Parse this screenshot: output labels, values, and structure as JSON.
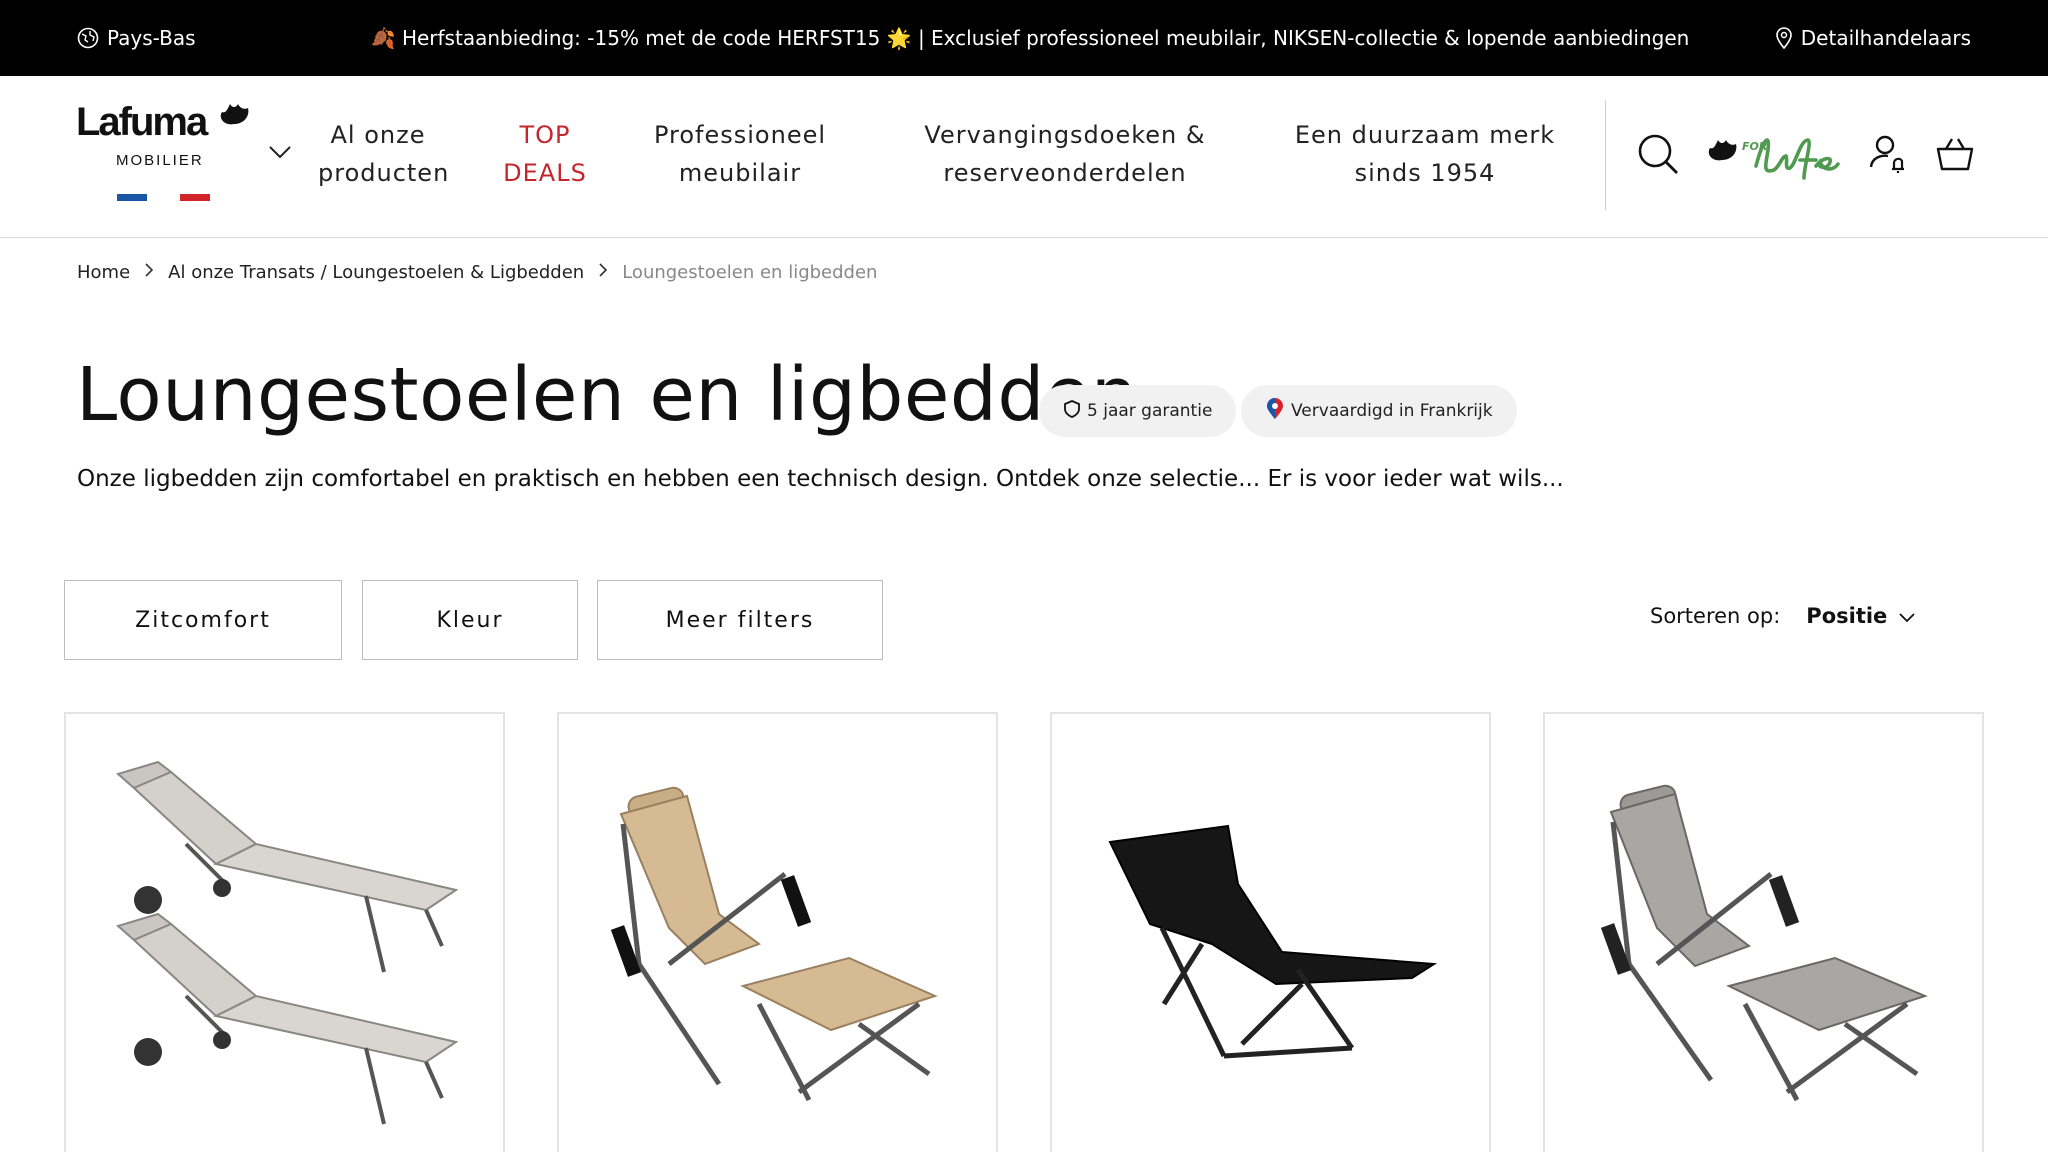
{
  "topbar": {
    "country": "Pays-Bas",
    "promo": "🍂 Herfstaanbieding: -15% met de code HERFST15 🌟 | Exclusief professioneel meubilair, NIKSEN-collectie & lopende aanbiedingen",
    "retailers": "Detailhandelaars"
  },
  "logo": {
    "brand": "Lafuma",
    "sub": "MOBILIER"
  },
  "nav": {
    "items": [
      {
        "line1": "Al onze",
        "line2": "producten"
      },
      {
        "line1": "TOP",
        "line2": "DEALS"
      },
      {
        "line1": "Professioneel",
        "line2": "meubilair"
      },
      {
        "line1": "Vervangingsdoeken &",
        "line2": "reserveonderdelen"
      },
      {
        "line1": "Een duurzaam merk",
        "line2": "sinds 1954"
      }
    ],
    "forlife_label": "FOR",
    "forlife_script": "life"
  },
  "breadcrumb": {
    "items": [
      "Home",
      "Al onze Transats / Loungestoelen & Ligbedden"
    ],
    "current": "Loungestoelen en ligbedden"
  },
  "page": {
    "title": "Loungestoelen en ligbedden",
    "badges": [
      "5 jaar garantie",
      "Vervaardigd in Frankrijk"
    ],
    "description": "Onze ligbedden zijn comfortabel en praktisch en hebben een technisch design. Ontdek onze selectie... Er is voor ieder wat wils..."
  },
  "filters": {
    "buttons": [
      "Zitcomfort",
      "Kleur",
      "Meer filters"
    ],
    "sort_label": "Sorteren op:",
    "sort_value": "Positie"
  },
  "colors": {
    "accent_red": "#c4262e",
    "flag_blue": "#1b55a6",
    "flag_red": "#d3242b",
    "forlife_green": "#4f9a4f"
  },
  "products": [
    {
      "image": "two-grey-sunloungers-on-wheels"
    },
    {
      "image": "beige-relax-chair-with-footrest"
    },
    {
      "image": "black-folding-lounge-chair"
    },
    {
      "image": "grey-relax-chair-with-footrest"
    }
  ]
}
